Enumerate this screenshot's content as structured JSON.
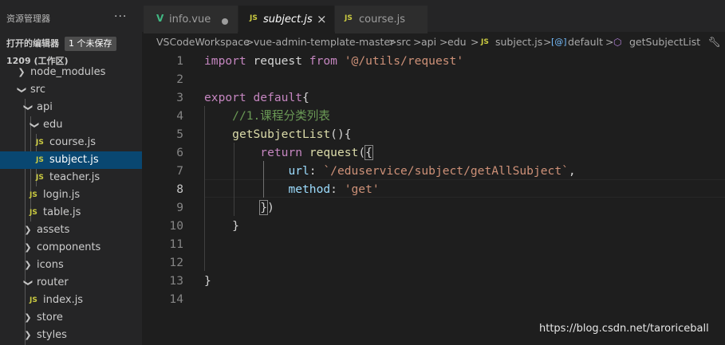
{
  "sidebar": {
    "title": "资源管理器",
    "more_label": "···",
    "open_editors": {
      "label": "打开的编辑器",
      "badge": "1 个未保存"
    },
    "workspace": {
      "label": "1209 (工作区)"
    },
    "tree": [
      {
        "label": "node_modules",
        "kind": "folder",
        "expanded": false
      },
      {
        "label": "src",
        "kind": "folder",
        "expanded": true
      },
      {
        "label": "api",
        "kind": "folder",
        "expanded": true
      },
      {
        "label": "edu",
        "kind": "folder",
        "expanded": true
      },
      {
        "label": "course.js",
        "kind": "file",
        "icon": "JS"
      },
      {
        "label": "subject.js",
        "kind": "file",
        "icon": "JS",
        "selected": true
      },
      {
        "label": "teacher.js",
        "kind": "file",
        "icon": "JS"
      },
      {
        "label": "login.js",
        "kind": "file",
        "icon": "JS"
      },
      {
        "label": "table.js",
        "kind": "file",
        "icon": "JS"
      },
      {
        "label": "assets",
        "kind": "folder",
        "expanded": false
      },
      {
        "label": "components",
        "kind": "folder",
        "expanded": false
      },
      {
        "label": "icons",
        "kind": "folder",
        "expanded": false
      },
      {
        "label": "router",
        "kind": "folder",
        "expanded": true
      },
      {
        "label": "index.js",
        "kind": "file",
        "icon": "JS"
      },
      {
        "label": "store",
        "kind": "folder",
        "expanded": false
      },
      {
        "label": "styles",
        "kind": "folder",
        "expanded": false
      }
    ]
  },
  "tabs": [
    {
      "label": "info.vue",
      "icon": "V",
      "dirty": true,
      "active": false
    },
    {
      "label": "subject.js",
      "icon": "JS",
      "active": true,
      "close": "×"
    },
    {
      "label": "course.js",
      "icon": "JS",
      "active": false
    }
  ],
  "breadcrumb": {
    "items": [
      "VSCodeWorkspace",
      "vue-admin-template-master",
      "src",
      "api",
      "edu"
    ],
    "file": "subject.js",
    "file_icon": "JS",
    "symbol1": "default",
    "symbol1_icon": "[@]",
    "symbol2": "getSubjectList",
    "symbol2_icon": "cube",
    "separator": ">"
  },
  "editor": {
    "current_line": 8,
    "line_numbers": [
      "1",
      "2",
      "3",
      "4",
      "5",
      "6",
      "7",
      "8",
      "9",
      "10",
      "11",
      "12",
      "13",
      "14"
    ],
    "code": {
      "l1": {
        "kw": "import",
        "id": " request ",
        "kw2": "from",
        "str": "'@/utils/request'"
      },
      "l3": {
        "kw": "export",
        "kw2": "default",
        "p": "{"
      },
      "l4": {
        "cm": "//1.课程分类列表"
      },
      "l5": {
        "fn": "getSubjectList",
        "p": "(){"
      },
      "l6": {
        "kw": "return",
        "fn": "request",
        "p1": "(",
        "p2": "{"
      },
      "l7": {
        "prop": "url",
        "p1": ": ",
        "str": "`/eduservice/subject/getAllSubject`",
        "p2": ","
      },
      "l8": {
        "prop": "method",
        "p1": ": ",
        "str": "'get'"
      },
      "l9": {
        "p1": "}",
        "p2": ")"
      },
      "l10": {
        "p": "}"
      },
      "l13": {
        "p": "}"
      }
    }
  },
  "watermark": "https://blog.csdn.net/taroriceball",
  "colors": {
    "keyword": "#c586c0",
    "keyword_blue": "#569cd6",
    "string": "#ce9178",
    "comment": "#6a9955",
    "function": "#dcdcaa",
    "property": "#9cdcfe",
    "selection": "#094771",
    "js_icon": "#cbcb41"
  }
}
